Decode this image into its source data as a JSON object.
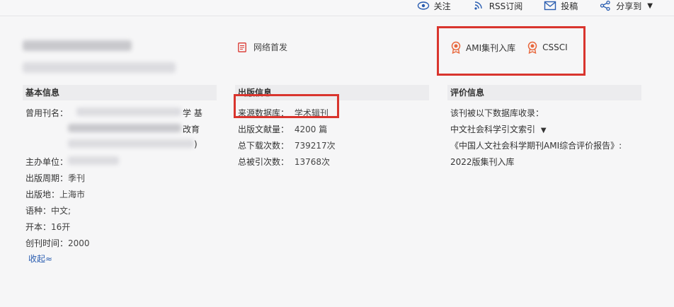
{
  "topbar": {
    "follow_label": "关注",
    "rss_label": "RSS订阅",
    "submit_label": "投稿",
    "share_label": "分享到"
  },
  "journal": {
    "first_publish_label": "网络首发"
  },
  "evaluation_badges": [
    {
      "label": "AMI集刊入库"
    },
    {
      "label": "CSSCI"
    }
  ],
  "basic_info": {
    "header": "基本信息",
    "former_name_label": "曾用刊名：",
    "former_name_tail_1": "学 基",
    "former_name_tail_2": "改育",
    "former_name_tail_3": ")",
    "sponsor_label": "主办单位：",
    "cycle_label": "出版周期：",
    "cycle_value": "季刊",
    "place_label": "出版地：",
    "place_value": "上海市",
    "language_label": "语种：",
    "language_value": "中文;",
    "format_label": "开本：",
    "format_value": "16开",
    "founded_label": "创刊时间：",
    "founded_value": "2000",
    "collapse_label": "收起≈"
  },
  "pub_info": {
    "header": "出版信息",
    "source_db_label": "来源数据库：",
    "source_db_value": "学术辑刊",
    "articles_label": "出版文献量：",
    "articles_value": "4200 篇",
    "downloads_label": "总下载次数：",
    "downloads_value": "739217次",
    "citations_label": "总被引次数：",
    "citations_value": "13768次"
  },
  "eval_info": {
    "header": "评价信息",
    "included_label": "该刊被以下数据库收录：",
    "index_name": "中文社会科学引文索引",
    "report_title": "《中国人文社会科学期刊AMI综合评价报告》:",
    "report_year": "2022版集刊入库"
  },
  "colors": {
    "highlight_box": "#d9352e",
    "link": "#2a5db0",
    "badge_orange": "#e8673c"
  }
}
